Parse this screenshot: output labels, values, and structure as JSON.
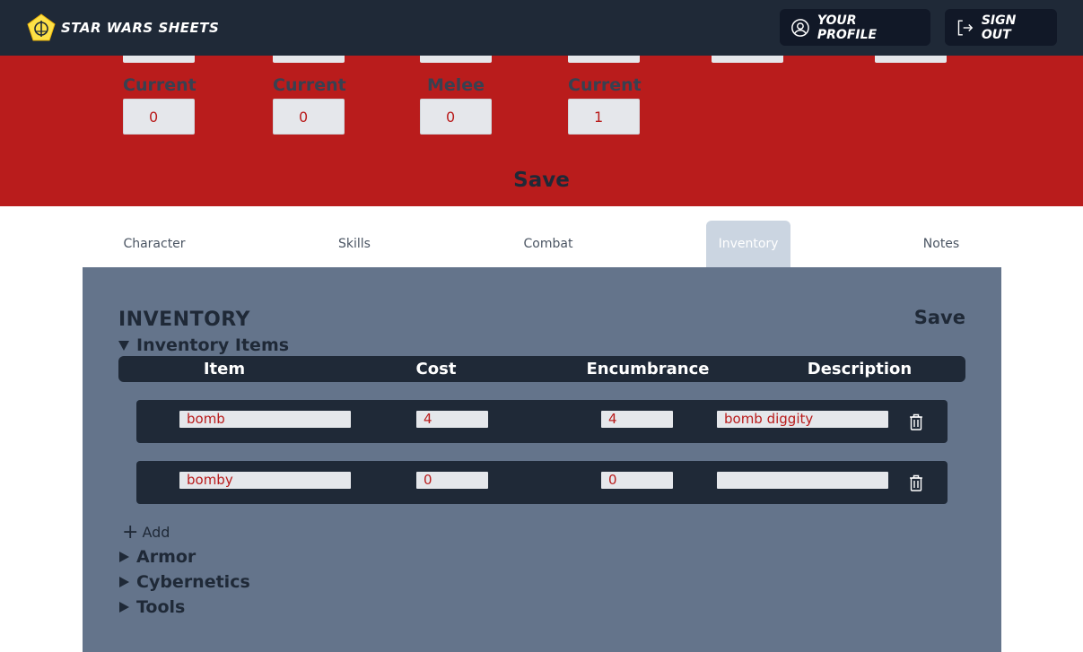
{
  "header": {
    "app_name": "STAR WARS SHEETS",
    "profile_label": "YOUR PROFILE",
    "signout_label": "SIGN OUT"
  },
  "stats": {
    "items": [
      {
        "label": "Current",
        "value": "0"
      },
      {
        "label": "Current",
        "value": "0"
      },
      {
        "label": "Melee",
        "value": "0"
      },
      {
        "label": "Current",
        "value": "1"
      }
    ],
    "save_label": "Save"
  },
  "tabs": [
    {
      "label": "Character",
      "active": false
    },
    {
      "label": "Skills",
      "active": false
    },
    {
      "label": "Combat",
      "active": false
    },
    {
      "label": "Inventory",
      "active": true
    },
    {
      "label": "Notes",
      "active": false
    }
  ],
  "inventory": {
    "title": "INVENTORY",
    "save_label": "Save",
    "items_section": "Inventory Items",
    "columns": [
      "Item",
      "Cost",
      "Encumbrance",
      "Description"
    ],
    "rows": [
      {
        "item": "bomb",
        "cost": "4",
        "encumbrance": "4",
        "description": "bomb diggity"
      },
      {
        "item": "bomby",
        "cost": "0",
        "encumbrance": "0",
        "description": ""
      }
    ],
    "add_label": "Add",
    "sections": [
      "Armor",
      "Cybernetics",
      "Tools"
    ]
  },
  "colors": {
    "header_bg": "#1f2937",
    "stats_bg": "#b91c1c",
    "panel_bg": "#64748b",
    "active_tab_bg": "#cbd5e1",
    "input_text": "#b91c1c"
  },
  "icons": {
    "logo": "rebel-emblem-icon",
    "profile": "user-circle-icon",
    "signout": "sign-out-icon",
    "delete": "trash-icon",
    "add": "plus-icon"
  }
}
